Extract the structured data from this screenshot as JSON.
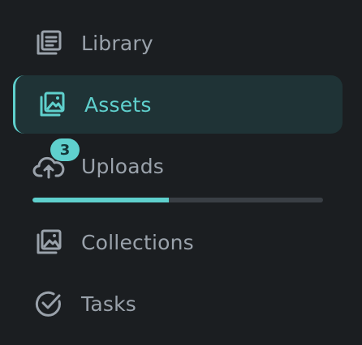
{
  "nav": {
    "items": [
      {
        "label": "Library",
        "icon": "library-icon"
      },
      {
        "label": "Assets",
        "icon": "image-stack-icon",
        "active": true
      },
      {
        "label": "Uploads",
        "icon": "cloud-upload-icon",
        "badge": "3",
        "progress": 0.47
      },
      {
        "label": "Collections",
        "icon": "collections-icon"
      },
      {
        "label": "Tasks",
        "icon": "check-circle-icon"
      }
    ]
  },
  "colors": {
    "background": "#1b1e21",
    "accent": "#5fd0cd",
    "active_background": "#1f3336",
    "text_muted": "#9aa2ab",
    "progress_track": "#3a3f45"
  }
}
